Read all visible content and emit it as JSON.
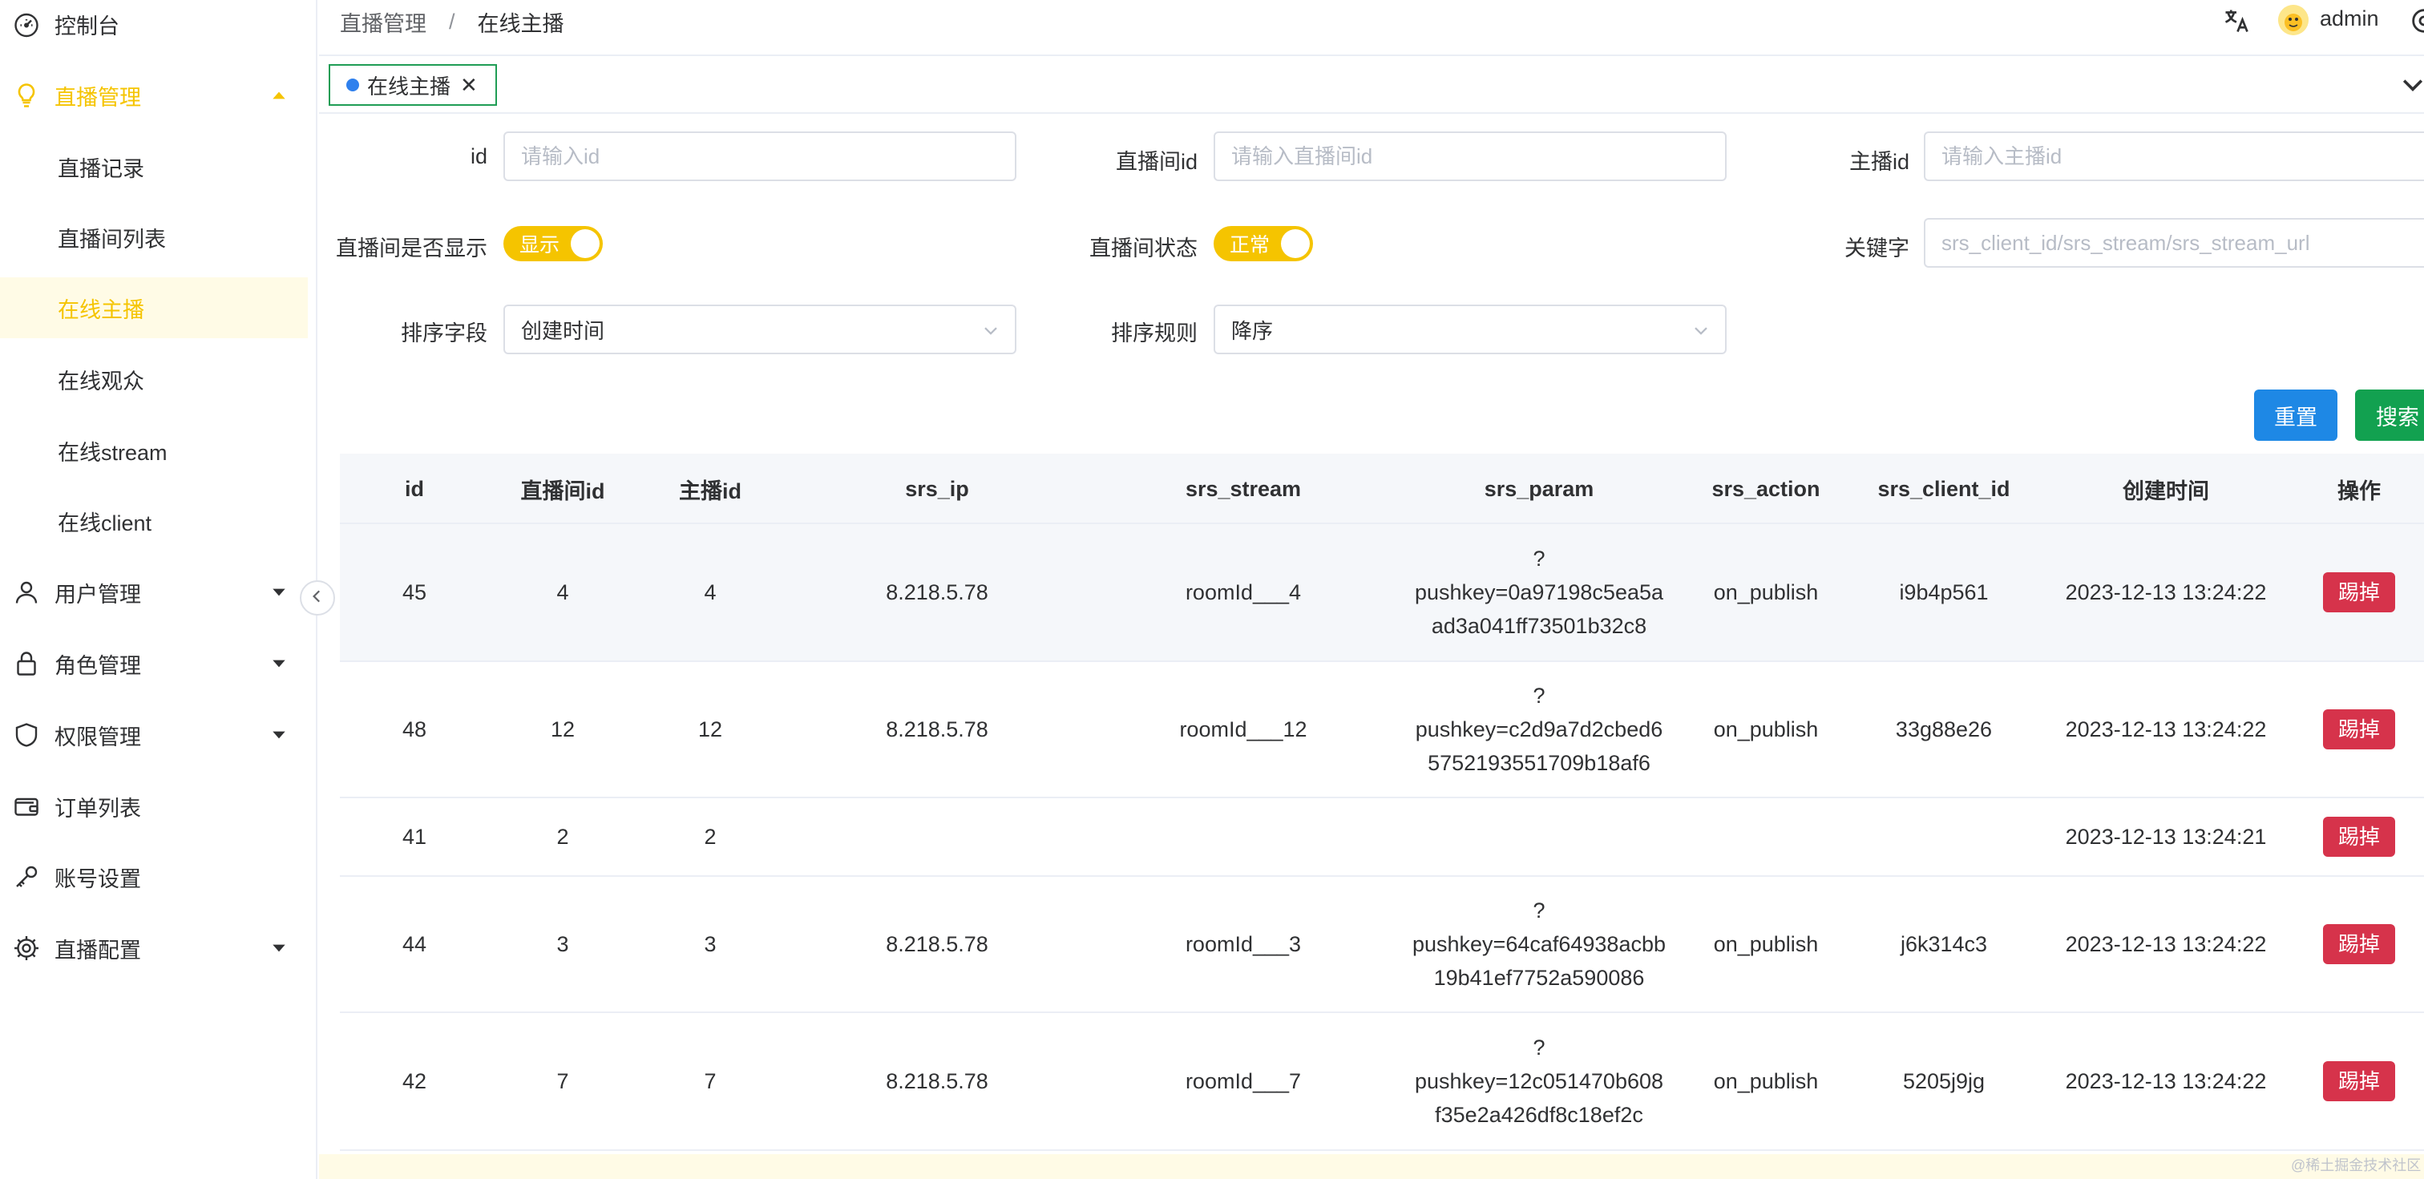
{
  "sidebar": {
    "items": [
      {
        "label": "控制台",
        "icon": "dashboard-icon"
      },
      {
        "label": "直播管理",
        "icon": "bulb-icon"
      },
      {
        "label": "用户管理",
        "icon": "user-icon"
      },
      {
        "label": "角色管理",
        "icon": "lock-icon"
      },
      {
        "label": "权限管理",
        "icon": "shield-icon"
      },
      {
        "label": "订单列表",
        "icon": "wallet-icon"
      },
      {
        "label": "账号设置",
        "icon": "key-icon"
      },
      {
        "label": "直播配置",
        "icon": "gear-icon"
      }
    ],
    "sub_items": [
      "直播记录",
      "直播间列表",
      "在线主播",
      "在线观众",
      "在线stream",
      "在线client"
    ]
  },
  "header": {
    "breadcrumb_parent": "直播管理",
    "breadcrumb_sep": "/",
    "breadcrumb_current": "在线主播",
    "username": "admin"
  },
  "tags": {
    "active_tag": "在线主播",
    "close": "✕"
  },
  "filters": {
    "id_label": "id",
    "id_placeholder": "请输入id",
    "room_id_label": "直播间id",
    "room_id_placeholder": "请输入直播间id",
    "anchor_id_label": "主播id",
    "anchor_id_placeholder": "请输入主播id",
    "show_label": "直播间是否显示",
    "show_value": "显示",
    "status_label": "直播间状态",
    "status_value": "正常",
    "keyword_label": "关键字",
    "keyword_placeholder": "srs_client_id/srs_stream/srs_stream_url",
    "sort_field_label": "排序字段",
    "sort_field_value": "创建时间",
    "sort_rule_label": "排序规则",
    "sort_rule_value": "降序"
  },
  "buttons": {
    "reset": "重置",
    "search": "搜索"
  },
  "table": {
    "columns": [
      "id",
      "直播间id",
      "主播id",
      "srs_ip",
      "srs_stream",
      "srs_param",
      "srs_action",
      "srs_client_id",
      "创建时间",
      "操作"
    ],
    "kick_label": "踢掉",
    "rows": [
      {
        "id": "45",
        "room_id": "4",
        "anchor_id": "4",
        "srs_ip": "8.218.5.78",
        "srs_stream": "roomId___4",
        "param_1": "?",
        "param_2": "pushkey=0a97198c5ea5a",
        "param_3": "ad3a041ff73501b32c8",
        "srs_action": "on_publish",
        "srs_client_id": "i9b4p561",
        "created": "2023-12-13 13:24:22"
      },
      {
        "id": "48",
        "room_id": "12",
        "anchor_id": "12",
        "srs_ip": "8.218.5.78",
        "srs_stream": "roomId___12",
        "param_1": "?",
        "param_2": "pushkey=c2d9a7d2cbed6",
        "param_3": "5752193551709b18af6",
        "srs_action": "on_publish",
        "srs_client_id": "33g88e26",
        "created": "2023-12-13 13:24:22"
      },
      {
        "id": "41",
        "room_id": "2",
        "anchor_id": "2",
        "srs_ip": "",
        "srs_stream": "",
        "param_1": "",
        "param_2": "",
        "param_3": "",
        "srs_action": "",
        "srs_client_id": "",
        "created": "2023-12-13 13:24:21"
      },
      {
        "id": "44",
        "room_id": "3",
        "anchor_id": "3",
        "srs_ip": "8.218.5.78",
        "srs_stream": "roomId___3",
        "param_1": "?",
        "param_2": "pushkey=64caf64938acbb",
        "param_3": "19b41ef7752a590086",
        "srs_action": "on_publish",
        "srs_client_id": "j6k314c3",
        "created": "2023-12-13 13:24:22"
      },
      {
        "id": "42",
        "room_id": "7",
        "anchor_id": "7",
        "srs_ip": "8.218.5.78",
        "srs_stream": "roomId___7",
        "param_1": "?",
        "param_2": "pushkey=12c051470b608",
        "param_3": "f35e2a426df8c18ef2c",
        "srs_action": "on_publish",
        "srs_client_id": "5205j9jg",
        "created": "2023-12-13 13:24:22"
      }
    ]
  },
  "watermark": "@稀土掘金技术社区",
  "colors": {
    "accent": "#f5c400",
    "primary": "#1e88e5",
    "success": "#12a150",
    "danger": "#d6334b"
  }
}
